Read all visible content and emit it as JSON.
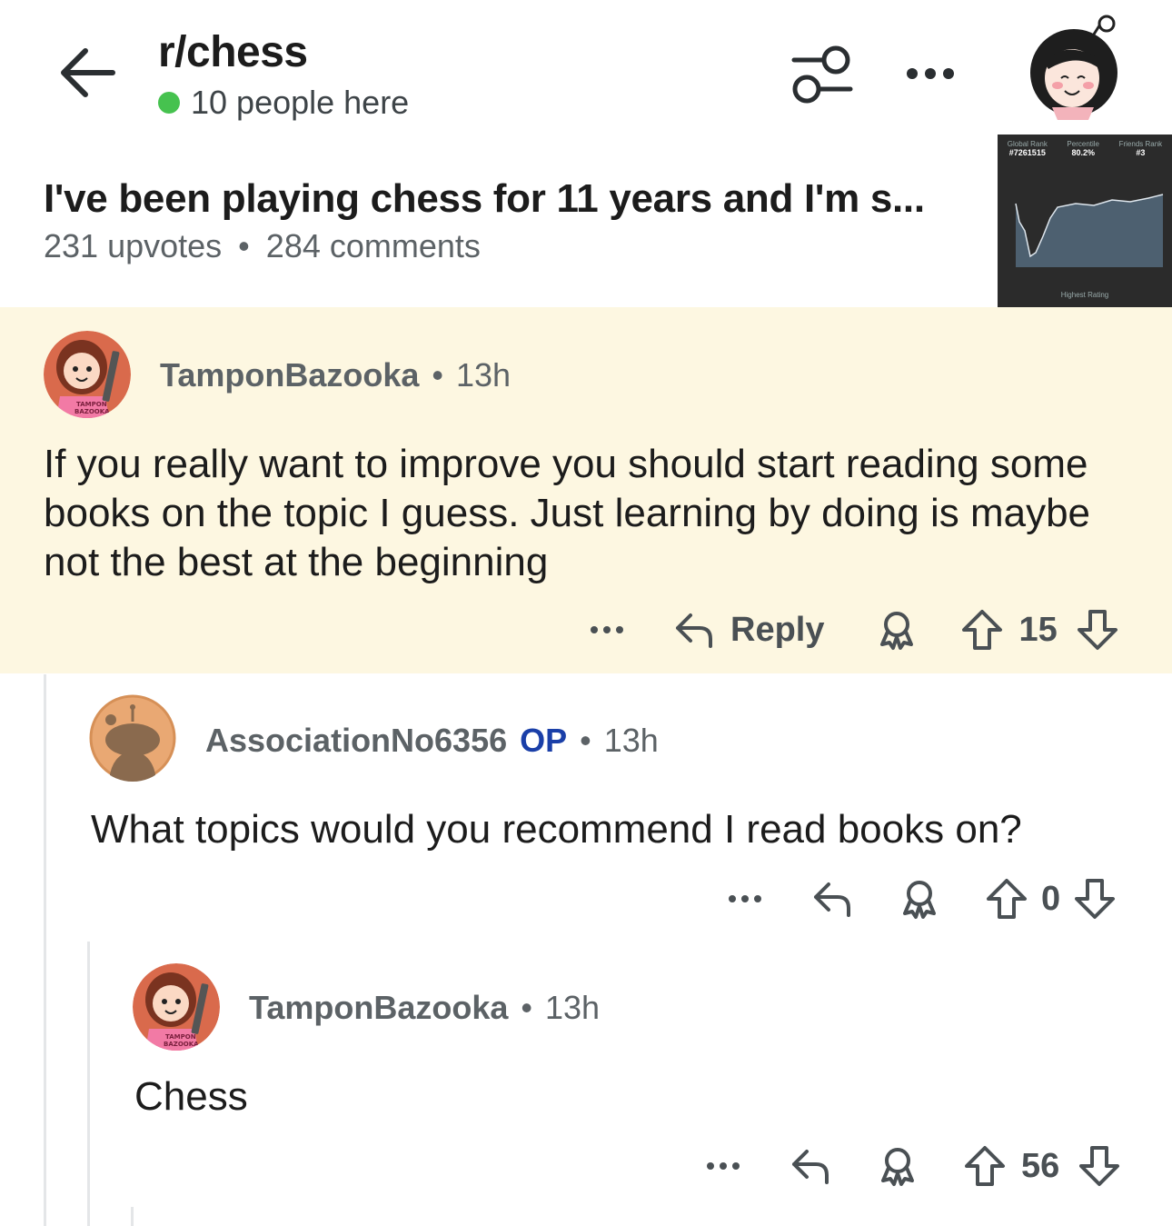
{
  "header": {
    "subreddit": "r/chess",
    "online_text": "10 people here",
    "online_color": "#46c24f",
    "back_icon": "arrow-left-icon",
    "filter_icon": "filter-toggle-icon",
    "more_icon": "ellipsis-icon"
  },
  "post": {
    "title": "I've been playing chess for 11 years and I'm s...",
    "upvotes": "231 upvotes",
    "meta_sep": "•",
    "comments": "284 comments",
    "thumbnail": {
      "stat1_label": "Global Rank",
      "stat1_value": "#7261515",
      "stat2_label": "Percentile",
      "stat2_value": "80.2%",
      "stat3_label": "Friends Rank",
      "stat3_value": "#3",
      "foot_label": "Highest Rating"
    }
  },
  "comments": [
    {
      "author": "TamponBazooka",
      "op": "",
      "sep": "•",
      "time": "13h",
      "text": "If you really want to improve you should start reading some books on the topic I guess. Just learning by doing is maybe not the best at the beginning",
      "reply_label": "Reply",
      "score": "15",
      "highlighted": true
    },
    {
      "author": "AssociationNo6356",
      "op": "OP",
      "sep": "•",
      "time": "13h",
      "text": "What topics would you recommend I read books on?",
      "score": "0"
    },
    {
      "author": "TamponBazooka",
      "sep": "•",
      "time": "13h",
      "text": "Chess",
      "score": "56"
    }
  ],
  "colors": {
    "highlight_bg": "#fdf7e1",
    "op_badge": "#1a3fa8",
    "meta_text": "#5c6266"
  }
}
